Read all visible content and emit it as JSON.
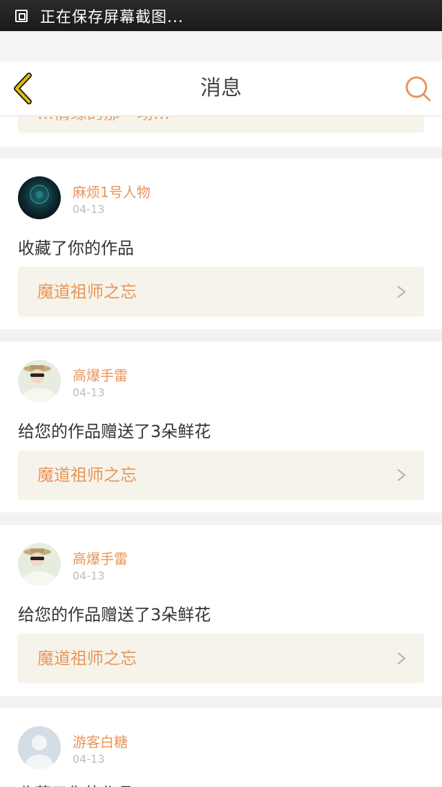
{
  "status_bar": {
    "text": "正在保存屏幕截图..."
  },
  "header": {
    "title": "消息"
  },
  "partial_item": {
    "work_title": "…情缘的那一场…"
  },
  "messages": [
    {
      "user": "麻烦1号人物",
      "date": "04-13",
      "action": "收藏了你的作品",
      "work_title": "魔道祖师之忘"
    },
    {
      "user": "高爆手雷",
      "date": "04-13",
      "action": "给您的作品赠送了3朵鲜花",
      "work_title": "魔道祖师之忘"
    },
    {
      "user": "高爆手雷",
      "date": "04-13",
      "action": "给您的作品赠送了3朵鲜花",
      "work_title": "魔道祖师之忘"
    },
    {
      "user": "游客白糖",
      "date": "04-13",
      "action": "收藏了你的作品",
      "work_title": ""
    }
  ],
  "colors": {
    "accent": "#e8955a",
    "link_bg": "#f6f4ea",
    "back_icon": "#e6c200"
  }
}
